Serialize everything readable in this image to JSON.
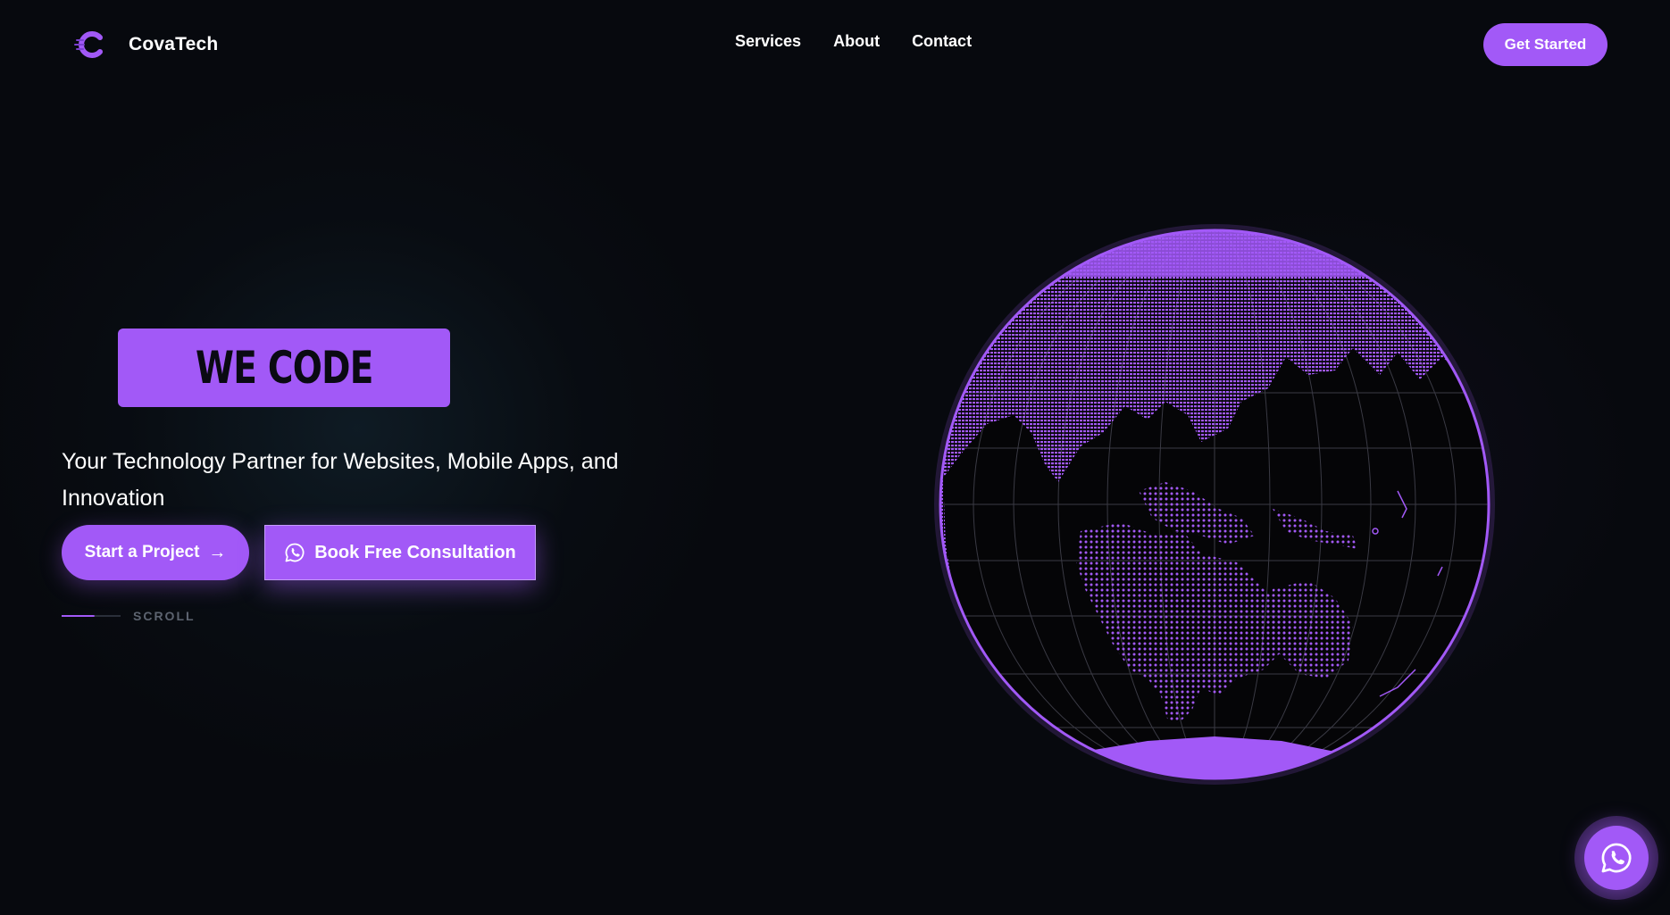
{
  "header": {
    "brand": {
      "name": "CovaTech",
      "logo_icon": "c-logo-icon"
    },
    "nav": [
      {
        "label": "Services"
      },
      {
        "label": "About"
      },
      {
        "label": "Contact"
      }
    ],
    "cta_label": "Get Started"
  },
  "hero": {
    "badge": "WE CODE",
    "tagline": "Your Technology Partner for Websites, Mobile Apps, and Innovation",
    "primary_button": {
      "label": "Start a Project",
      "icon": "arrow-right-icon"
    },
    "secondary_button": {
      "label": "Book Free Consultation",
      "icon": "whatsapp-icon"
    },
    "scroll_label": "SCROLL"
  },
  "floating_button": {
    "icon": "whatsapp-icon"
  },
  "colors": {
    "accent": "#a259f7",
    "background": "#07090e",
    "text": "#ffffff",
    "muted": "#5d6470"
  }
}
